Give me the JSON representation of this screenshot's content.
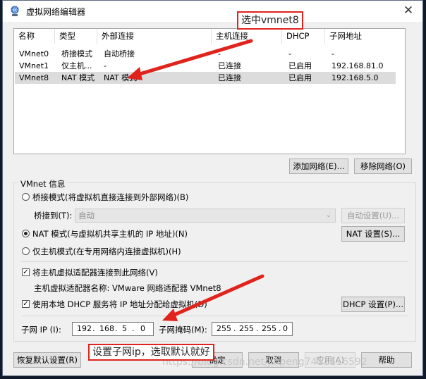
{
  "window": {
    "title": "虚拟网络编辑器",
    "close_glyph": "✕"
  },
  "table": {
    "headers": [
      "名称",
      "类型",
      "外部连接",
      "主机连接",
      "DHCP",
      "子网地址"
    ],
    "rows": [
      [
        "VMnet0",
        "桥接模式",
        "自动桥接",
        "-",
        "-",
        "-"
      ],
      [
        "VMnet1",
        "仅主机...",
        "-",
        "已连接",
        "已启用",
        "192.168.81.0"
      ],
      [
        "VMnet8",
        "NAT 模式",
        "NAT 模式",
        "已连接",
        "已启用",
        "192.168.5.0"
      ]
    ],
    "selected_row": 2
  },
  "buttons": {
    "add_network": "添加网络(E)...",
    "remove_network": "移除网络(O)",
    "auto_settings": "自动设置(U)...",
    "nat_settings": "NAT 设置(S)...",
    "dhcp_settings": "DHCP 设置(P)...",
    "restore_defaults": "恢复默认设置(R)",
    "ok": "确定",
    "cancel": "取消",
    "apply": "应用(A)",
    "help": "帮助"
  },
  "vmnet_info": {
    "group_label": "VMnet 信息",
    "bridge_mode": "桥接模式(将虚拟机直接连接到外部网络)(B)",
    "bridged_to_label": "桥接到(T):",
    "bridged_to_value": "自动",
    "nat_mode": "NAT 模式(与虚拟机共享主机的 IP 地址)(N)",
    "host_only_mode": "仅主机模式(在专用网络内连接虚拟机)(H)",
    "selected_mode": "nat",
    "connect_adapter": "将主机虚拟适配器连接到此网络(V)",
    "connect_adapter_checked": true,
    "adapter_name": "主机虚拟适配器名称: VMware 网络适配器 VMnet8",
    "use_dhcp": "使用本地 DHCP 服务将 IP 地址分配给虚拟机(D)",
    "use_dhcp_checked": true,
    "subnet_ip_label": "子网 IP (I):",
    "subnet_ip": [
      "192",
      "168",
      "5",
      "0"
    ],
    "subnet_mask_label": "子网掩码(M):",
    "subnet_mask": [
      "255",
      "255",
      "255",
      "0"
    ]
  },
  "annotations": {
    "callout_top": "选中vmnet8",
    "callout_bottom": "设置子网ip，选取默认就好",
    "watermark": "https://blog.csdn.net/jinpeng7411116592",
    "color": "#e0231c"
  }
}
